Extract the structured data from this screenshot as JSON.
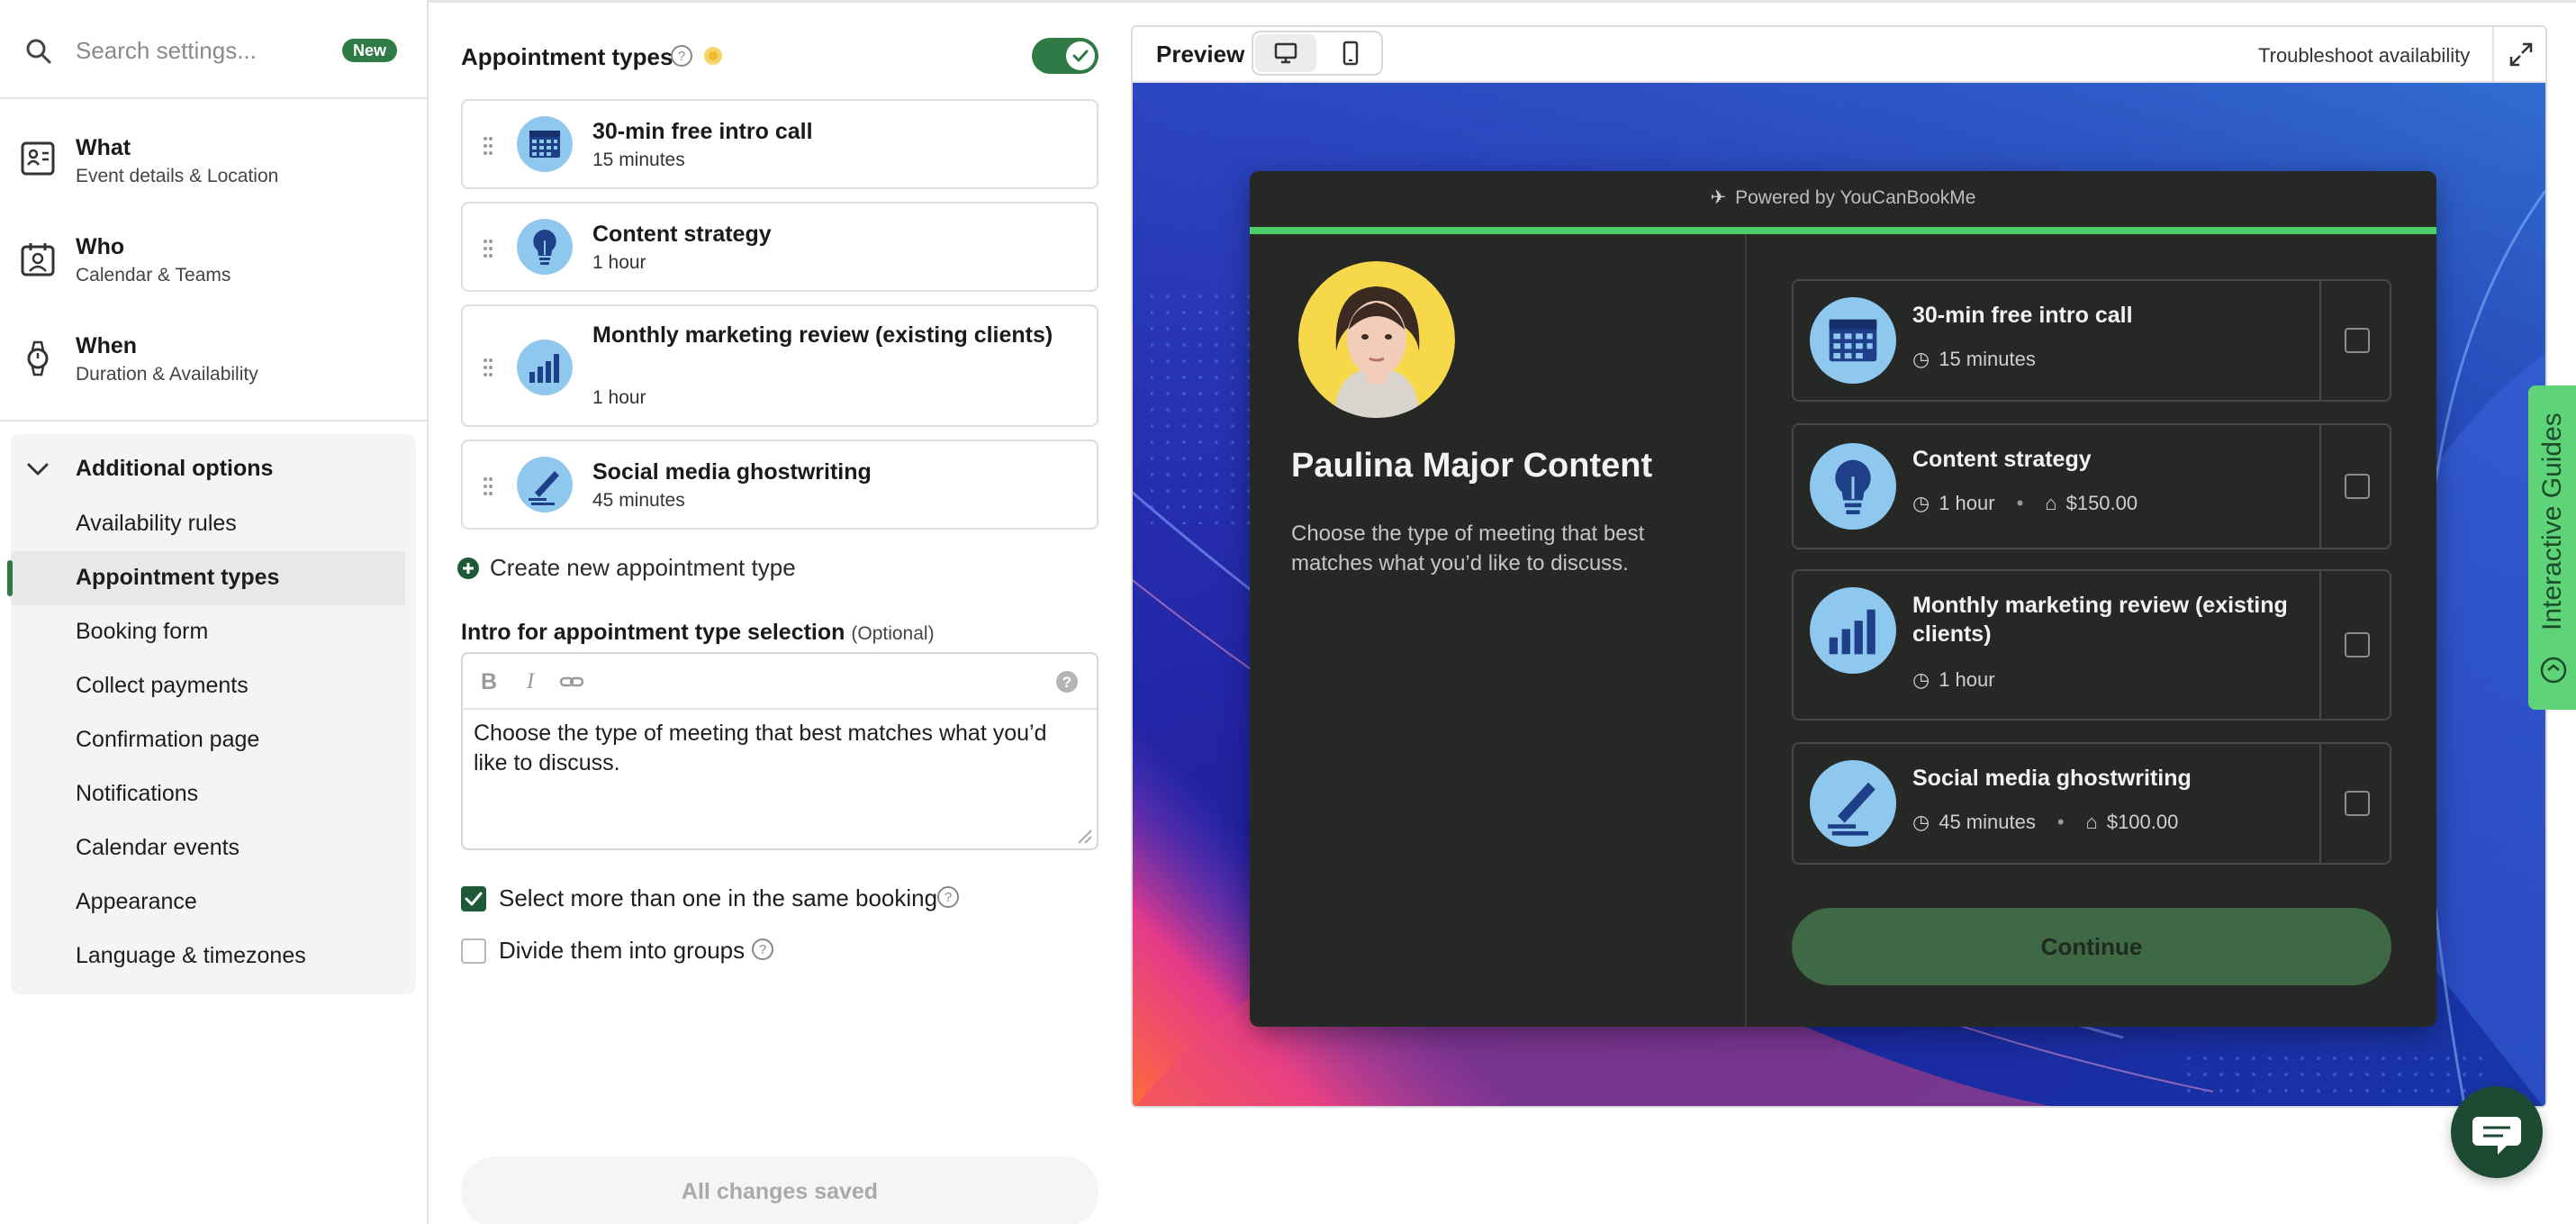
{
  "sidebar": {
    "search": {
      "placeholder": "Search settings...",
      "badge": "New"
    },
    "main_items": [
      {
        "title": "What",
        "subtitle": "Event details & Location",
        "icon": "contact-card-icon"
      },
      {
        "title": "Who",
        "subtitle": "Calendar & Teams",
        "icon": "people-icon"
      },
      {
        "title": "When",
        "subtitle": "Duration & Availability",
        "icon": "watch-icon"
      }
    ],
    "additional": {
      "title": "Additional options",
      "items": [
        "Availability rules",
        "Appointment types",
        "Booking form",
        "Collect payments",
        "Confirmation page",
        "Notifications",
        "Calendar events",
        "Appearance",
        "Language & timezones"
      ],
      "active": "Appointment types"
    }
  },
  "editor": {
    "section_title": "Appointment types",
    "toggle_on": true,
    "appointment_types": [
      {
        "name": "30-min free intro call",
        "duration": "15 minutes",
        "icon": "calendar-icon"
      },
      {
        "name": "Content strategy",
        "duration": "1 hour",
        "icon": "lightbulb-icon"
      },
      {
        "name": "Monthly marketing review (existing clients)",
        "duration": "1 hour",
        "icon": "bar-chart-icon"
      },
      {
        "name": "Social media ghostwriting",
        "duration": "45 minutes",
        "icon": "pen-icon"
      }
    ],
    "create_link": "Create new appointment type",
    "intro_label": "Intro for appointment type selection",
    "intro_optional": "(Optional)",
    "intro_text": "Choose the type of meeting that best matches what you’d like to discuss.",
    "options": [
      {
        "label": "Select more than one in the same booking",
        "checked": true
      },
      {
        "label": "Divide them into groups",
        "checked": false
      }
    ],
    "save_status": "All changes saved"
  },
  "preview": {
    "title": "Preview",
    "troubleshoot": "Troubleshoot availability",
    "powered_by": "Powered by YouCanBookMe",
    "host_name": "Paulina Major Content",
    "intro": "Choose the type of meeting that best matches what you’d like to discuss.",
    "options": [
      {
        "name": "30-min free intro call",
        "duration": "15 minutes",
        "price": ""
      },
      {
        "name": "Content strategy",
        "duration": "1 hour",
        "price": "$150.00"
      },
      {
        "name": "Monthly marketing review (existing clients)",
        "duration": "1 hour",
        "price": ""
      },
      {
        "name": "Social media ghostwriting",
        "duration": "45 minutes",
        "price": "$100.00"
      }
    ],
    "continue_label": "Continue"
  },
  "guides": {
    "label": "Interactive Guides"
  },
  "colors": {
    "brand_green": "#2f7a45",
    "accent_bar": "#4ccf6a",
    "card_bg": "#262825",
    "guides_tab": "#5fd378",
    "chat_button": "#1d4a33"
  }
}
